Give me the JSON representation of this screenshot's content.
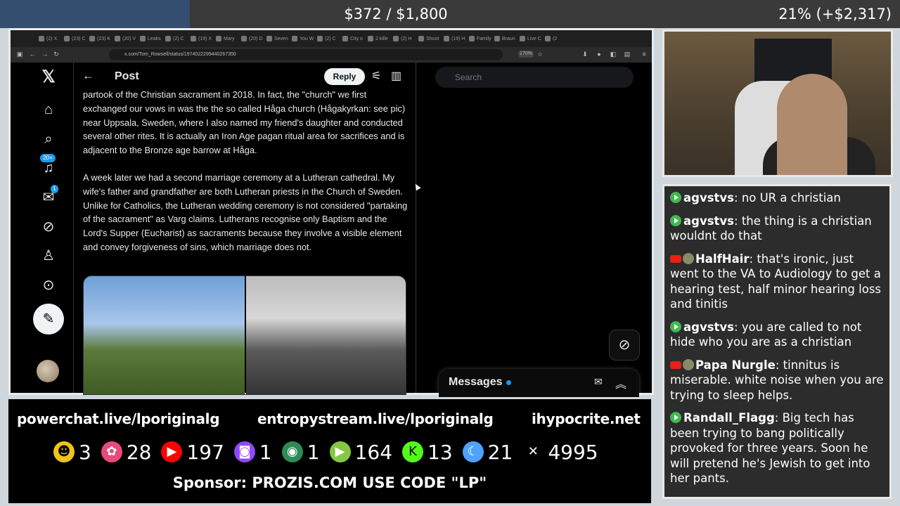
{
  "overlay": {
    "money": "$372 / $1,800",
    "percent": "21% (+$2,317)"
  },
  "browser": {
    "url": "x.com/Tom_Rowsell/status/1974022299440267350",
    "zoom": "170%",
    "tabs": [
      "(2) X",
      "(23) C",
      "(23) K",
      "(20) V",
      "Leaks",
      "(2) C",
      "(19) X",
      "Mary",
      "(20) D",
      "Seven",
      "You W",
      "(2) C",
      "City o",
      "2 kille",
      "(2) H",
      "Shoot",
      "(19) H",
      "Family",
      "Braun",
      "Live C",
      "(2"
    ]
  },
  "x": {
    "header_title": "Post",
    "reply_label": "Reply",
    "search_placeholder": "Search",
    "notifications_badge": "20+",
    "messages_badge": "1",
    "messages_label": "Messages",
    "body_paragraph_1": "partook of the Christian sacrament in 2018. In fact, the \"church\" we first exchanged our vows in was the the so called Håga church (Hågakyrkan: see pic) near Uppsala, Sweden, where I also named my friend's daughter and conducted several other rites. It is actually an Iron Age pagan ritual area for sacrifices and is adjacent to the Bronze age barrow at Håga.",
    "body_paragraph_2": "A week later we had a second marriage ceremony at a Lutheran cathedral. My wife's father and grandfather are both Lutheran priests in the Church of Sweden. Unlike for Catholics, the Lutheran wedding ceremony is not considered \"partaking of the sacrament\" as Varg claims. Lutherans recognise only Baptism and the Lord's Supper (Eucharist) as sacraments because they involve a visible element and convey forgiveness of sins, which marriage does not."
  },
  "bottom": {
    "link1": "powerchat.live/lporiginalg",
    "link2": "entropystream.live/lporiginalg",
    "link3": "ihypocrite.net",
    "stats": [
      {
        "icon": "rumble-like-icon",
        "value": "3",
        "color": "#f0c419"
      },
      {
        "icon": "kick-flower-icon",
        "value": "28",
        "color": "#e84a7a"
      },
      {
        "icon": "youtube-icon",
        "value": "197",
        "color": "#ff0000"
      },
      {
        "icon": "twitch-icon",
        "value": "1",
        "color": "#9146ff"
      },
      {
        "icon": "orb-icon",
        "value": "1",
        "color": "#2e8b57"
      },
      {
        "icon": "rumble-icon",
        "value": "164",
        "color": "#85c742"
      },
      {
        "icon": "kick-icon",
        "value": "13",
        "color": "#53fc18"
      },
      {
        "icon": "moon-icon",
        "value": "21",
        "color": "#4da3ff"
      },
      {
        "icon": "x-icon",
        "value": "4995",
        "color": "#ffffff"
      }
    ],
    "sponsor": "Sponsor: PROZIS.COM USE CODE \"LP\""
  },
  "chat": [
    {
      "platform": "rumble",
      "user": "agvstvs",
      "text": "no UR a christian"
    },
    {
      "platform": "rumble",
      "user": "agvstvs",
      "text": "the thing is a christian wouldnt do that"
    },
    {
      "platform": "youtube",
      "user": "HalfHair",
      "text": "that's ironic, just went to the VA to Audiology to get a hearing test, half minor hearing loss and tinitis"
    },
    {
      "platform": "rumble",
      "user": "agvstvs",
      "text": "you are called to not hide who you are as a christian"
    },
    {
      "platform": "youtube",
      "user": "Papa Nurgle",
      "text": "tinnitus is miserable. white noise when you are trying to sleep helps."
    },
    {
      "platform": "rumble",
      "user": "Randall_Flagg",
      "text": "Big tech has been trying to bang politically provoked for three years. Soon he will pretend he's Jewish to get into her pants."
    }
  ]
}
